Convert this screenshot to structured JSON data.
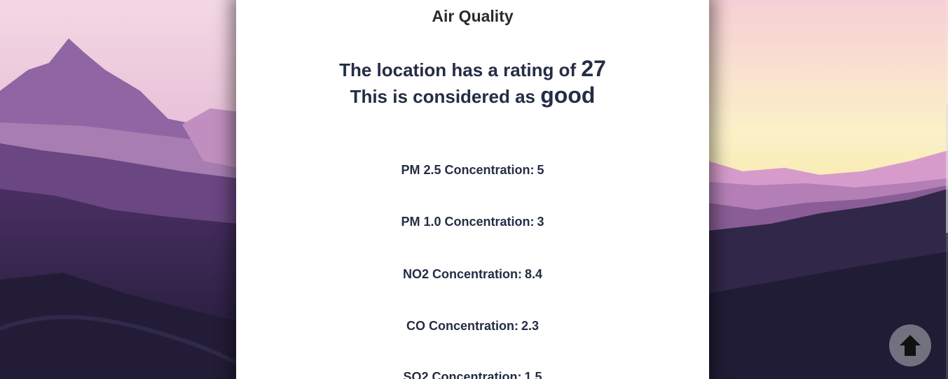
{
  "page": {
    "title": "Air Quality"
  },
  "rating": {
    "prefix": "The location has a rating of",
    "value": "27",
    "category_prefix": "This is considered as",
    "category": "good"
  },
  "metrics": [
    {
      "label": "PM 2.5 Concentration:",
      "value": "5"
    },
    {
      "label": "PM 1.0 Concentration:",
      "value": "3"
    },
    {
      "label": "NO2 Concentration:",
      "value": "8.4"
    },
    {
      "label": "CO Concentration:",
      "value": "2.3"
    },
    {
      "label": "SO2 Concentration:",
      "value": "1.5"
    }
  ],
  "back_to_top": {
    "icon": "arrow-up-icon"
  },
  "colors": {
    "panel_bg": "#ffffff",
    "text": "#252d45",
    "button_bg": "#80808c"
  }
}
